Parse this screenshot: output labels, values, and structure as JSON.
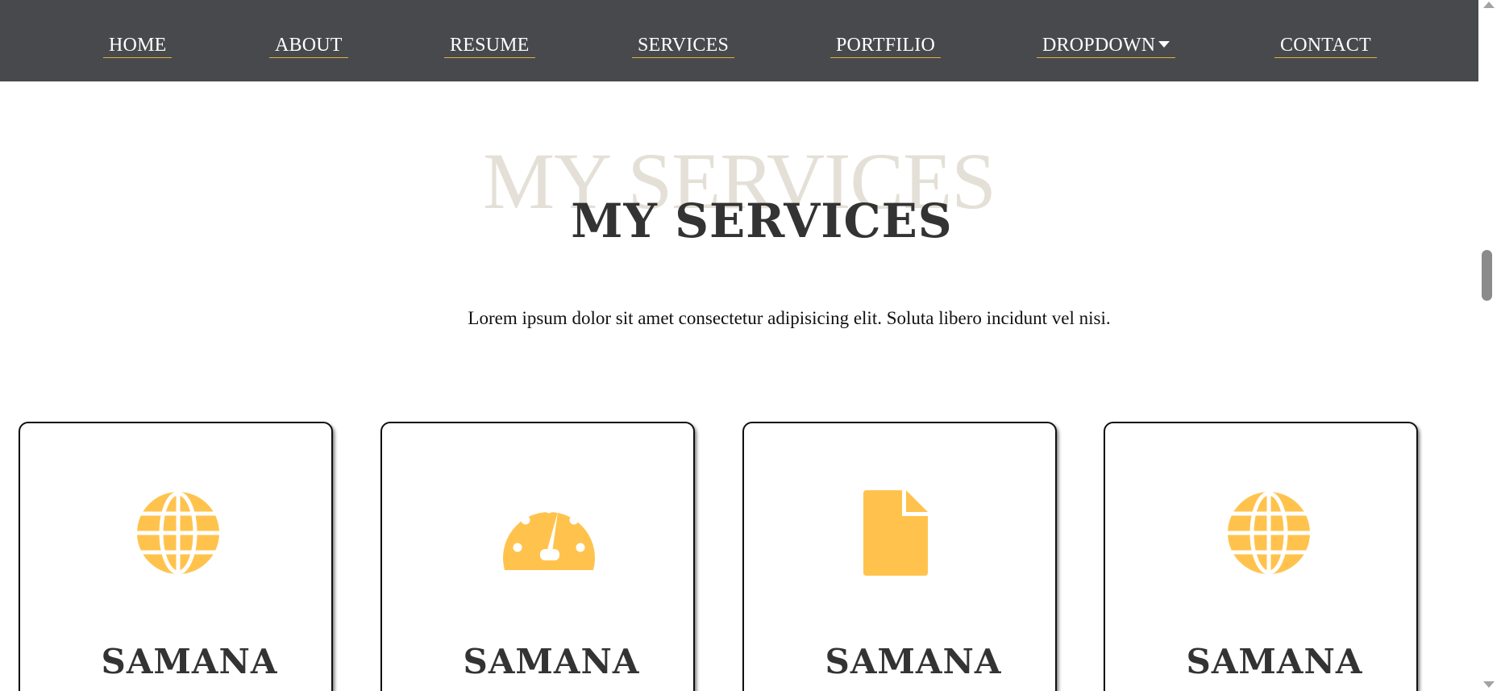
{
  "nav": {
    "items": [
      {
        "label": "HOME"
      },
      {
        "label": "ABOUT"
      },
      {
        "label": "RESUME"
      },
      {
        "label": "SERVICES"
      },
      {
        "label": "PORTFILIO"
      },
      {
        "label": "DROPDOWN",
        "icon": "caret-down-icon"
      },
      {
        "label": "CONTACT"
      }
    ]
  },
  "section": {
    "bg_title": "MY SERVICES",
    "title": "MY SERVICES",
    "subtitle": "Lorem ipsum dolor sit amet consectetur adipisicing elit. Soluta libero incidunt vel nisi."
  },
  "services": [
    {
      "icon": "globe-icon",
      "title": "SAMANA"
    },
    {
      "icon": "dashboard-icon",
      "title": "SAMANA"
    },
    {
      "icon": "file-icon",
      "title": "SAMANA"
    },
    {
      "icon": "globe-icon",
      "title": "SAMANA"
    }
  ],
  "colors": {
    "nav_bg": "#48494c",
    "accent": "#ffc34d",
    "underline": "#e0b23d",
    "heading": "#333333",
    "bg_title": "#e4e0d7"
  }
}
